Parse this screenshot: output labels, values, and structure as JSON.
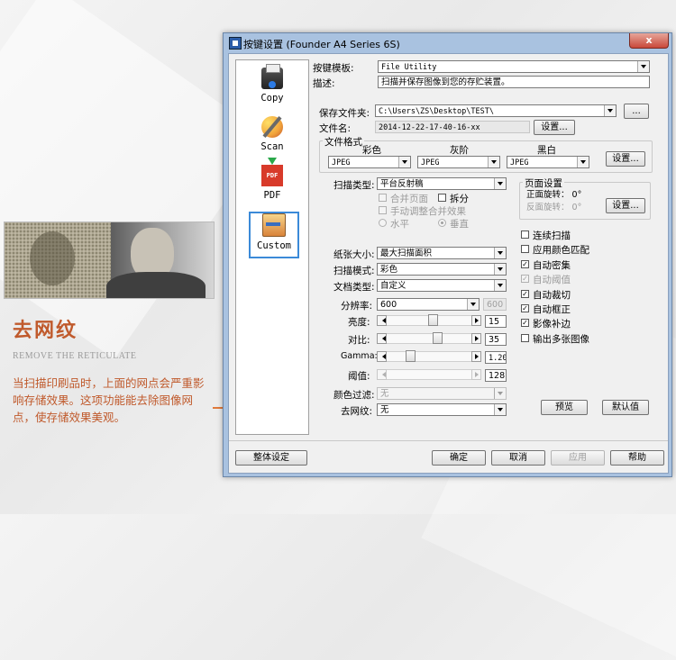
{
  "promo": {
    "title": "去网纹",
    "subtitle": "REMOVE THE RETICULATE",
    "description": "当扫描印刷品时，上面的网点会严重影响存储效果。这项功能能去除图像网点，使存储效果美观。"
  },
  "window": {
    "title": "按键设置 (Founder A4 Series 6S)",
    "close": "x"
  },
  "nav": {
    "items": [
      {
        "label": "Copy"
      },
      {
        "label": "Scan"
      },
      {
        "label": "PDF",
        "icon_text": "PDF"
      },
      {
        "label": "Custom"
      }
    ]
  },
  "form": {
    "template_label": "按键模板:",
    "template_value": "File Utility",
    "desc_label": "描述:",
    "desc_value": "扫描并保存图像到您的存贮装置。",
    "save_folder_label": "保存文件夹:",
    "save_folder_value": "C:\\Users\\ZS\\Desktop\\TEST\\",
    "browse_label": "...",
    "filename_label": "文件名:",
    "filename_value": "2014-12-22-17-40-16-xx",
    "filename_settings": "设置...",
    "format_group": "文件格式",
    "fmt_color_label": "彩色",
    "fmt_gray_label": "灰阶",
    "fmt_bw_label": "黑白",
    "fmt_color_value": "JPEG",
    "fmt_gray_value": "JPEG",
    "fmt_bw_value": "JPEG",
    "format_settings": "设置...",
    "scan_type_label": "扫描类型:",
    "scan_type_value": "平台反射稿",
    "merge_label": "合并页面",
    "split_label": "拆分",
    "manual_merge_label": "手动调整合并效果",
    "horizontal_label": "水平",
    "vertical_label": "垂直",
    "paper_size_label": "纸张大小:",
    "paper_size_value": "最大扫描面积",
    "scan_mode_label": "扫描模式:",
    "scan_mode_value": "彩色",
    "doc_type_label": "文档类型:",
    "doc_type_value": "自定义",
    "dpi_label": "分辨率:",
    "dpi_value": "600",
    "dpi_extra": "600",
    "brightness_label": "亮度:",
    "brightness_value": "15",
    "contrast_label": "对比:",
    "contrast_value": "35",
    "gamma_label": "Gamma:",
    "gamma_value": "1.20",
    "threshold_label": "阈值:",
    "threshold_value": "128",
    "color_filter_label": "颜色过滤:",
    "color_filter_value": "无",
    "descreen_label": "去网纹:",
    "descreen_value": "无"
  },
  "sliders": {
    "brightness": 0.55,
    "contrast": 0.62,
    "gamma": 0.25,
    "threshold": 0.0
  },
  "page_settings": {
    "group": "页面设置",
    "front_rotate": "正面旋转： 0°",
    "back_rotate": "反面旋转： 0°",
    "settings": "设置..."
  },
  "options": [
    {
      "label": "连续扫描",
      "checked": false,
      "disabled": false
    },
    {
      "label": "应用颜色匹配",
      "checked": false,
      "disabled": false
    },
    {
      "label": "自动密集",
      "checked": true,
      "disabled": false
    },
    {
      "label": "自动阈值",
      "checked": true,
      "disabled": true
    },
    {
      "label": "自动裁切",
      "checked": true,
      "disabled": false
    },
    {
      "label": "自动框正",
      "checked": true,
      "disabled": false
    },
    {
      "label": "影像补边",
      "checked": true,
      "disabled": false
    },
    {
      "label": "输出多张图像",
      "checked": false,
      "disabled": false
    }
  ],
  "buttons": {
    "preview": "预览",
    "default": "默认值",
    "global": "整体设定",
    "ok": "确定",
    "cancel": "取消",
    "apply": "应用",
    "help": "帮助"
  },
  "checkmark": "✓"
}
